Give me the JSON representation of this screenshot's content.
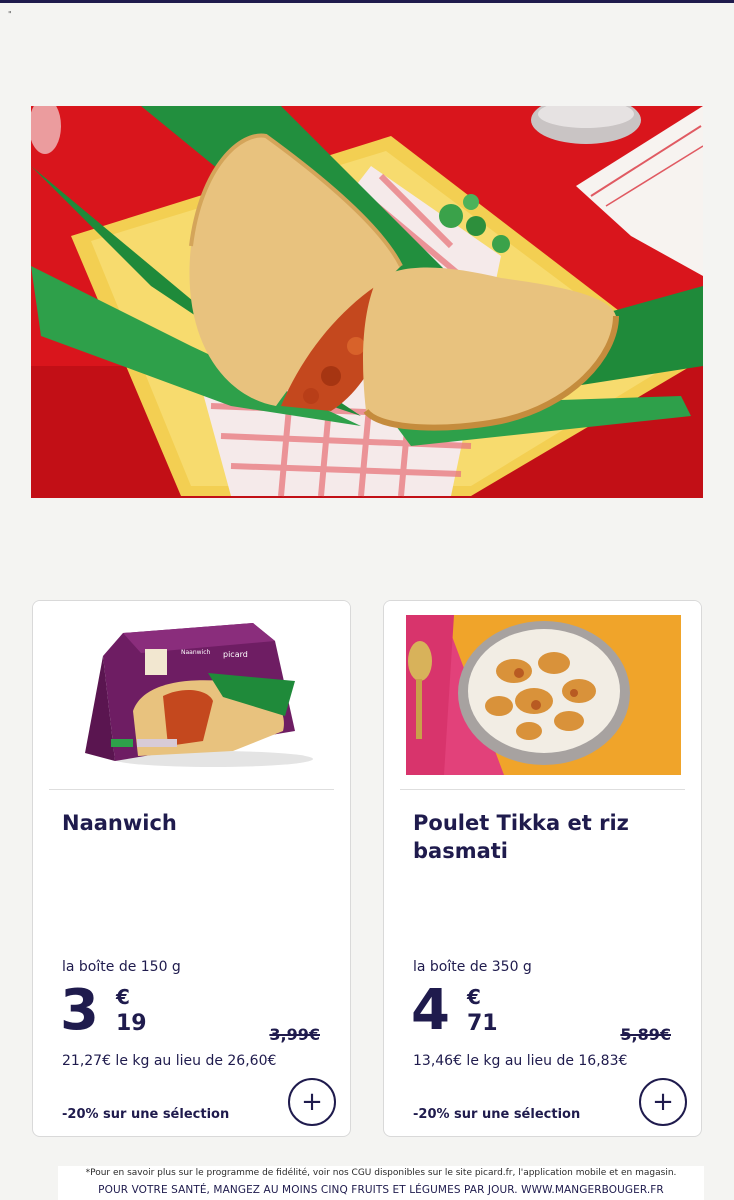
{
  "header": {
    "mark": "\""
  },
  "hero": {
    "alt_icon": "naanwich-hero-image"
  },
  "products": [
    {
      "name": "Naanwich",
      "pack": "la boîte de 150 g",
      "price_int": "3",
      "price_currency": "€",
      "price_dec": "19",
      "old_price": "3,99€",
      "per_kg": "21,27€ le kg au lieu de 26,60€",
      "promo": "-20% sur une sélection",
      "add_label": "+",
      "package_text": "Naanwich",
      "brand": "picard"
    },
    {
      "name": "Poulet Tikka et riz basmati",
      "pack": "la boîte de 350 g",
      "price_int": "4",
      "price_currency": "€",
      "price_dec": "71",
      "old_price": "5,89€",
      "per_kg": "13,46€ le kg au lieu de 16,83€",
      "promo": "-20% sur une sélection",
      "add_label": "+"
    }
  ],
  "footer": {
    "note": "*Pour en savoir plus sur le programme de fidélité, voir nos CGU disponibles sur le site picard.fr, l'application mobile et en magasin.",
    "health": "POUR VOTRE SANTÉ, MANGEZ AU MOINS CINQ FRUITS ET LÉGUMES PAR JOUR. WWW.MANGERBOUGER.FR"
  },
  "colors": {
    "navy": "#1f1b4d",
    "hero_bg": "#d9151c",
    "tray": "#f3cf52",
    "leaf": "#1f8a3a"
  }
}
